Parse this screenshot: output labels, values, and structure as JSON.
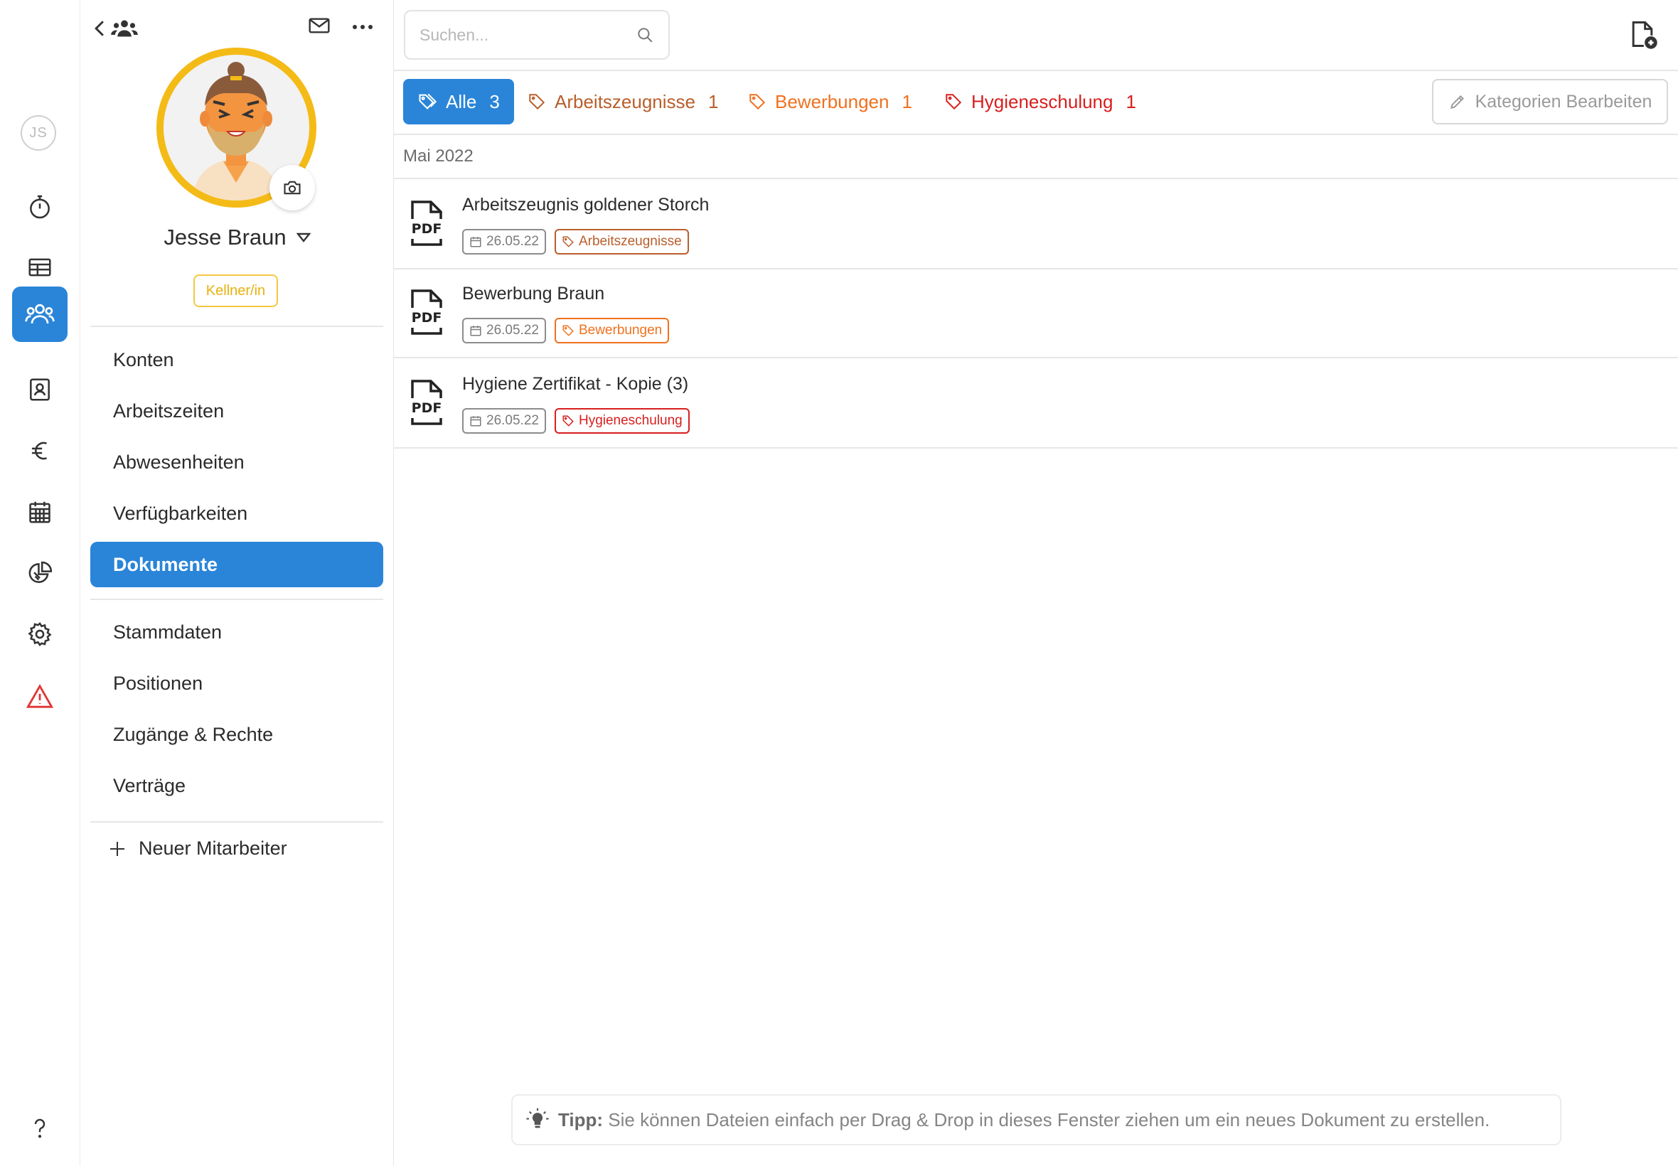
{
  "rail": {
    "user_initials": "JS",
    "icons": [
      "stopwatch-icon",
      "table-icon",
      "team-icon",
      "contact-card-icon",
      "euro-icon",
      "calendar-icon",
      "pie-chart-icon",
      "gear-icon",
      "warning-icon",
      "question-icon"
    ],
    "active_icon": "team-icon",
    "accent": "#2a85d8",
    "warning_color": "#e03636"
  },
  "panel": {
    "name": "Jesse Braun",
    "role": "Kellner/in",
    "role_color": "#f4c842",
    "photo_ring_color": "#f4bb17",
    "menu_group1": [
      "Konten",
      "Arbeitszeiten",
      "Abwesenheiten",
      "Verfügbarkeiten",
      "Dokumente"
    ],
    "active_item": "Dokumente",
    "menu_group2": [
      "Stammdaten",
      "Positionen",
      "Zugänge & Rechte",
      "Verträge"
    ],
    "new_employee": "Neuer Mitarbeiter"
  },
  "search": {
    "placeholder": "Suchen..."
  },
  "filters": [
    {
      "label": "Alle",
      "count": "3",
      "color": "#ffffff"
    },
    {
      "label": "Arbeitszeugnisse",
      "count": "1",
      "color": "#b95e2b"
    },
    {
      "label": "Bewerbungen",
      "count": "1",
      "color": "#f0711f"
    },
    {
      "label": "Hygieneschulung",
      "count": "1",
      "color": "#d81e1e"
    }
  ],
  "edit_categories": "Kategorien Bearbeiten",
  "month": "Mai 2022",
  "documents": [
    {
      "title": "Arbeitszeugnis goldener Storch",
      "date": "26.05.22",
      "tag": "Arbeitszeugnisse",
      "tag_color": "#b95e2b"
    },
    {
      "title": "Bewerbung Braun",
      "date": "26.05.22",
      "tag": "Bewerbungen",
      "tag_color": "#f0711f"
    },
    {
      "title": "Hygiene Zertifikat - Kopie (3)",
      "date": "26.05.22",
      "tag": "Hygieneschulung",
      "tag_color": "#d81e1e"
    }
  ],
  "tip": {
    "label": "Tipp:",
    "text": "Sie können Dateien einfach per Drag & Drop in dieses Fenster ziehen um ein neues Dokument zu erstellen."
  }
}
